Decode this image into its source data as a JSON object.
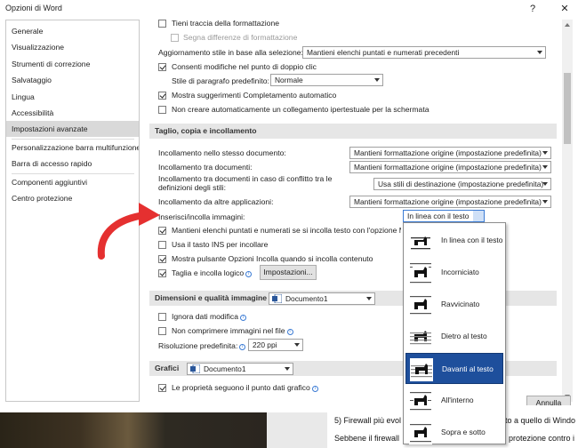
{
  "window": {
    "title": "Opzioni di Word",
    "help_label": "?",
    "close_label": "✕"
  },
  "sidebar": {
    "items": [
      {
        "label": "Generale"
      },
      {
        "label": "Visualizzazione"
      },
      {
        "label": "Strumenti di correzione"
      },
      {
        "label": "Salvataggio"
      },
      {
        "label": "Lingua"
      },
      {
        "label": "Accessibilità"
      },
      {
        "label": "Impostazioni avanzate",
        "selected": true
      },
      {
        "label": "Personalizzazione barra multifunzione"
      },
      {
        "label": "Barra di accesso rapido"
      },
      {
        "label": "Componenti aggiuntivi"
      },
      {
        "label": "Centro protezione"
      }
    ]
  },
  "editing": {
    "track_formatting": "Tieni traccia della formattazione",
    "mark_inconsistencies": "Segna differenze di formattazione",
    "update_style_label": "Aggiornamento stile in base alla selezione:",
    "update_style_value": "Mantieni elenchi puntati e numerati precedenti",
    "click_and_type": "Consenti modifiche nel punto di doppio clic",
    "default_style_label": "Stile di paragrafo predefinito:",
    "default_style_value": "Normale",
    "autocomplete": "Mostra suggerimenti Completamento automatico",
    "no_hyperlink": "Non creare automaticamente un collegamento ipertestuale per la schermata"
  },
  "cut_copy_paste": {
    "section_title": "Taglio, copia e incollamento",
    "rows": [
      {
        "label": "Incollamento nello stesso documento:",
        "value": "Mantieni formattazione origine (impostazione predefinita)"
      },
      {
        "label": "Incollamento tra documenti:",
        "value": "Mantieni formattazione origine (impostazione predefinita)"
      },
      {
        "label": "Incollamento tra documenti in caso di conflitto tra le definizioni degli stili:",
        "value": "Usa stili di destinazione (impostazione predefinita)"
      },
      {
        "label": "Incollamento da altre applicazioni:",
        "value": "Mantieni formattazione origine (impostazione predefinita)"
      }
    ],
    "insert_images_label": "Inserisci/incolla immagini:",
    "insert_images_value": "In linea con il testo",
    "keep_bullets": "Mantieni elenchi puntati e numerati se si incolla testo con l'opzione Man",
    "use_ins": "Usa il tasto INS per incollare",
    "show_paste_options": "Mostra pulsante Opzioni Incolla quando si incolla contenuto",
    "smart_cut": "Taglia e incolla logico",
    "settings_button": "Impostazioni..."
  },
  "image_size": {
    "section_title": "Dimensioni e qualità immagine",
    "document": "Documento1",
    "discard_editing": "Ignora dati modifica",
    "no_compress": "Non comprimere immagini nel file",
    "resolution_label": "Risoluzione predefinita:",
    "resolution_value": "220 ppi"
  },
  "charts": {
    "section_title": "Grafici",
    "document": "Documento1",
    "properties_follow": "Le proprietà seguono il punto dati grafico"
  },
  "dropdown": {
    "options": [
      {
        "label": "In linea con il testo"
      },
      {
        "label": "Incorniciato"
      },
      {
        "label": "Ravvicinato"
      },
      {
        "label": "Dietro al testo"
      },
      {
        "label": "Davanti al testo",
        "highlighted": true
      },
      {
        "label": "All'interno"
      },
      {
        "label": "Sopra e sotto"
      }
    ]
  },
  "footer": {
    "cancel_label": "Annulla"
  },
  "background_doc": {
    "line1": "5) Firewall più evol",
    "line1_end": "to a quello di Windo",
    "line2": "Sebbene il firewall",
    "line2_end": "protezione contro i"
  },
  "colors": {
    "highlight": "#1e4f9c",
    "arrow": "#e53030",
    "section_bg": "#e6e6e6"
  }
}
